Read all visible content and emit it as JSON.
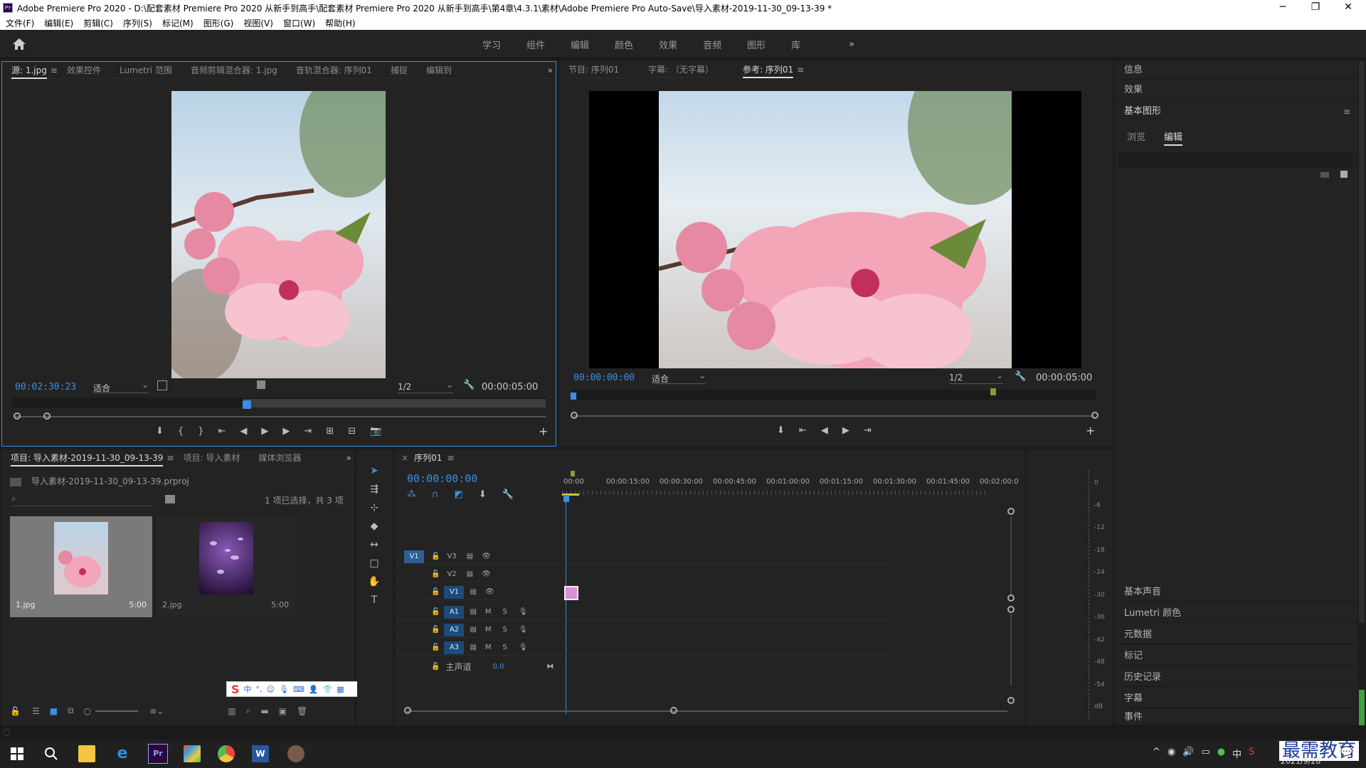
{
  "titlebar": {
    "title": "Adobe Premiere Pro 2020 - D:\\配套素材 Premiere Pro 2020 从新手到高手\\配套素材 Premiere Pro 2020 从新手到高手\\第4章\\4.3.1\\素材\\Adobe Premiere Pro Auto-Save\\导入素材-2019-11-30_09-13-39 *",
    "minimize": "─",
    "restore": "❐",
    "close": "✕"
  },
  "menu": [
    "文件(F)",
    "编辑(E)",
    "剪辑(C)",
    "序列(S)",
    "标记(M)",
    "图形(G)",
    "视图(V)",
    "窗口(W)",
    "帮助(H)"
  ],
  "workspaces": [
    "学习",
    "组件",
    "编辑",
    "颜色",
    "效果",
    "音频",
    "图形",
    "库"
  ],
  "workspaces_more": "»",
  "source_panel": {
    "tabs": [
      "源: 1.jpg",
      "效果控件",
      "Lumetri 范围",
      "音频剪辑混合器: 1.jpg",
      "音轨混合器: 序列01",
      "捕捉",
      "编辑到"
    ],
    "more": "»",
    "timecode": "00:02:30:23",
    "fit": "适合",
    "resolution": "1/2",
    "duration": "00:00:05:00"
  },
  "program_panel": {
    "tabs": [
      "节目: 序列01",
      "字幕: （无字幕）",
      "参考: 序列01"
    ],
    "timecode": "00:00:00:00",
    "fit": "适合",
    "resolution": "1/2",
    "duration": "00:00:05:00"
  },
  "right_panel": {
    "info": "信息",
    "effects": "效果",
    "essential_graphics": "基本图形",
    "subtabs": [
      "浏览",
      "编辑"
    ],
    "bottom_items": [
      "基本声音",
      "Lumetri 颜色",
      "元数据",
      "标记",
      "历史记录",
      "字幕",
      "事件"
    ]
  },
  "project_panel": {
    "tabs": [
      "项目: 导入素材-2019-11-30_09-13-39",
      "项目: 导入素材",
      "媒体浏览器"
    ],
    "more": "»",
    "project_file": "导入素材-2019-11-30_09-13-39.prproj",
    "selection_info": "1 项已选择，共 3 项",
    "items": [
      {
        "name": "1.jpg",
        "duration": "5:00"
      },
      {
        "name": "2.jpg",
        "duration": "5:00"
      }
    ]
  },
  "ime_toolbar": {
    "mode": "中",
    "punct": "°,"
  },
  "timeline": {
    "tab": "序列01",
    "timecode": "00:00:00:00",
    "ruler": [
      "00:00",
      "00:00:15:00",
      "00:00:30:00",
      "00:00:45:00",
      "00:01:00:00",
      "00:01:15:00",
      "00:01:30:00",
      "00:01:45:00",
      "00:02:00:0"
    ],
    "video_tracks": [
      "V3",
      "V2",
      "V1"
    ],
    "audio_tracks": [
      "A1",
      "A2",
      "A3"
    ],
    "source_patch": "V1",
    "master": "主声道",
    "master_value": "0.0",
    "mute": "M",
    "solo": "S"
  },
  "meter": {
    "ticks": [
      "0",
      "-6",
      "-12",
      "-18",
      "-24",
      "-30",
      "-36",
      "-42",
      "-48",
      "-54",
      "dB"
    ]
  },
  "tray": {
    "date": "2021/9/28",
    "watermark": "最需教育"
  },
  "colors": {
    "accent_blue": "#3a8ee6",
    "panel_bg": "#232323",
    "clip_pink": "#d98fd6",
    "track_blue": "#1c4a7a"
  }
}
